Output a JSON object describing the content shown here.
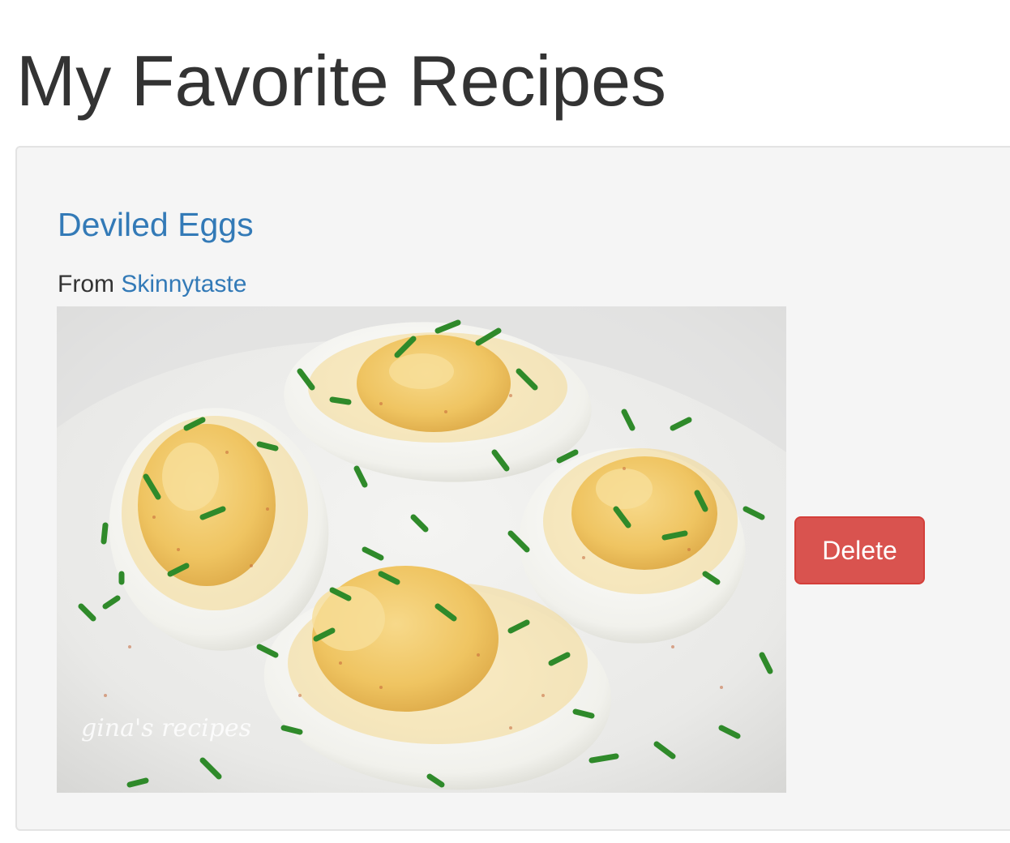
{
  "page": {
    "title": "My Favorite Recipes"
  },
  "recipe": {
    "title": "Deviled Eggs",
    "source_prefix": "From",
    "source_name": "Skinnytaste",
    "image_watermark": "gina's recipes",
    "delete_label": "Delete"
  },
  "colors": {
    "link": "#337ab7",
    "danger": "#d9534f",
    "well_background": "#f5f5f5",
    "heading": "#333333"
  }
}
